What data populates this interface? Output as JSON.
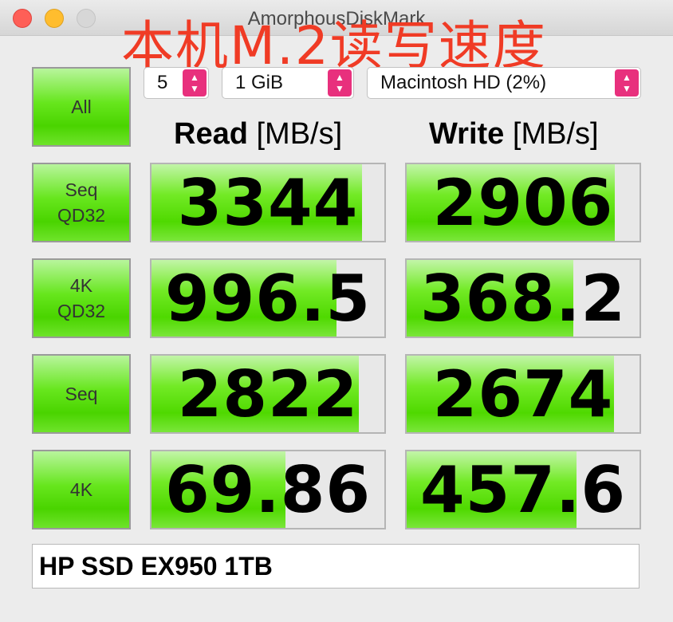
{
  "window": {
    "title": "AmorphousDiskMark"
  },
  "overlay_text": "本机M.2读写速度",
  "controls": {
    "count": "5",
    "size": "1 GiB",
    "drive": "Macintosh HD (2%)",
    "stepper_up": "▲",
    "stepper_down": "▼"
  },
  "all_button": "All",
  "headers": {
    "read": "Read",
    "write": "Write",
    "unit": "[MB/s]"
  },
  "tests": [
    {
      "label": "Seq\nQD32",
      "read": "3344",
      "write": "2906",
      "read_fill": 0.905,
      "write_fill": 0.895
    },
    {
      "label": "4K\nQD32",
      "read": "996.5",
      "write": "368.2",
      "read_fill": 0.795,
      "write_fill": 0.715
    },
    {
      "label": "Seq",
      "read": "2822",
      "write": "2674",
      "read_fill": 0.89,
      "write_fill": 0.89
    },
    {
      "label": "4K",
      "read": "69.86",
      "write": "457.6",
      "read_fill": 0.575,
      "write_fill": 0.73
    }
  ],
  "comment": "HP SSD EX950 1TB",
  "colors": {
    "green": "#4fd900",
    "stepper": "#e8307d",
    "overlay": "#f03b25"
  }
}
